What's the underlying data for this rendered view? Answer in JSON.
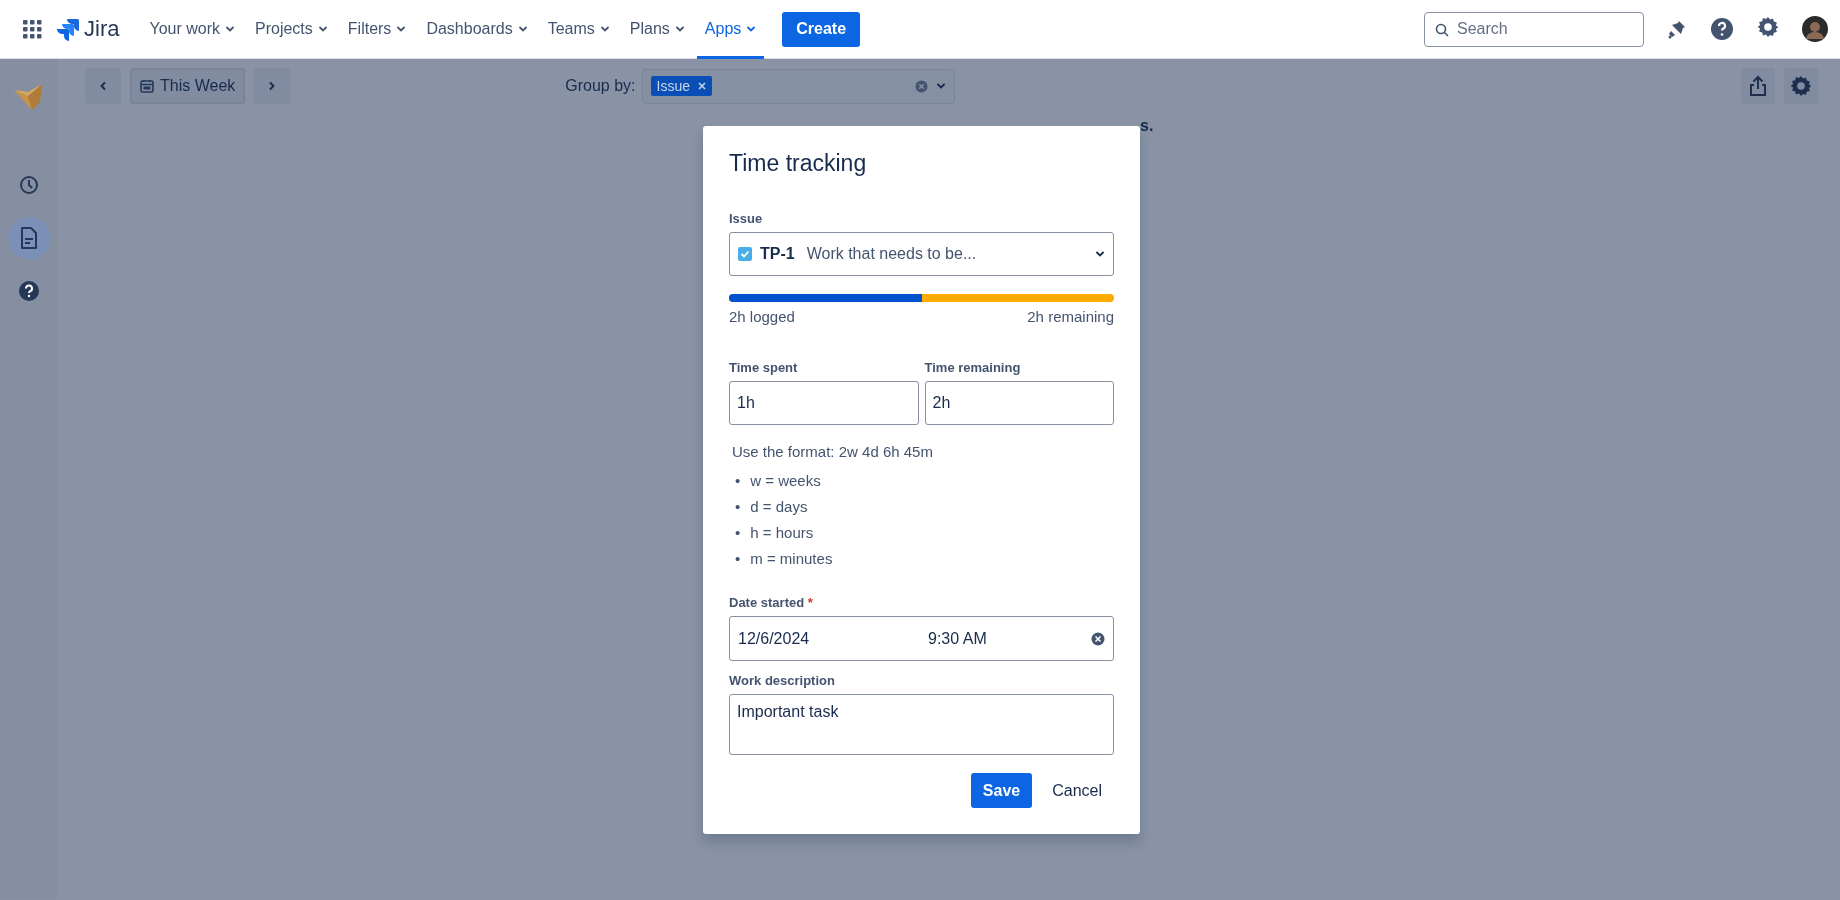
{
  "nav": {
    "product": "Jira",
    "items": [
      {
        "label": "Your work",
        "selected": false
      },
      {
        "label": "Projects",
        "selected": false
      },
      {
        "label": "Filters",
        "selected": false
      },
      {
        "label": "Dashboards",
        "selected": false
      },
      {
        "label": "Teams",
        "selected": false
      },
      {
        "label": "Plans",
        "selected": false
      },
      {
        "label": "Apps",
        "selected": true
      }
    ],
    "create": "Create",
    "search": {
      "placeholder": "Search"
    }
  },
  "sidebar": {
    "items": [
      {
        "kind": "clock",
        "selected": false
      },
      {
        "kind": "document",
        "selected": true
      },
      {
        "kind": "help",
        "selected": false
      }
    ]
  },
  "toolbar": {
    "period": "This Week",
    "group_by_label": "Group by:",
    "group_by_tags": [
      "Issue"
    ]
  },
  "background_text": "s.",
  "dialog": {
    "title": "Time tracking",
    "issue": {
      "label": "Issue",
      "key": "TP-1",
      "summary": "Work that needs to be..."
    },
    "progress": {
      "level": 0.5,
      "logged": "2h logged",
      "remaining": "2h remaining"
    },
    "time_spent": {
      "label": "Time spent",
      "value": "1h"
    },
    "time_remaining": {
      "label": "Time remaining",
      "value": "2h"
    },
    "hint": "Use the format: 2w 4d 6h 45m",
    "units": [
      {
        "bullet": "•",
        "text": "w = weeks"
      },
      {
        "bullet": "•",
        "text": "d = days"
      },
      {
        "bullet": "•",
        "text": "h = hours"
      },
      {
        "bullet": "•",
        "text": "m = minutes"
      }
    ],
    "date_started": {
      "label": "Date started",
      "required_mark": "*",
      "date": "12/6/2024",
      "time": "9:30 AM"
    },
    "work_description": {
      "label": "Work description",
      "value": "Important task"
    },
    "buttons": [
      {
        "kind": "primary",
        "label": "Save"
      },
      {
        "kind": "subtle",
        "label": "Cancel"
      }
    ]
  }
}
